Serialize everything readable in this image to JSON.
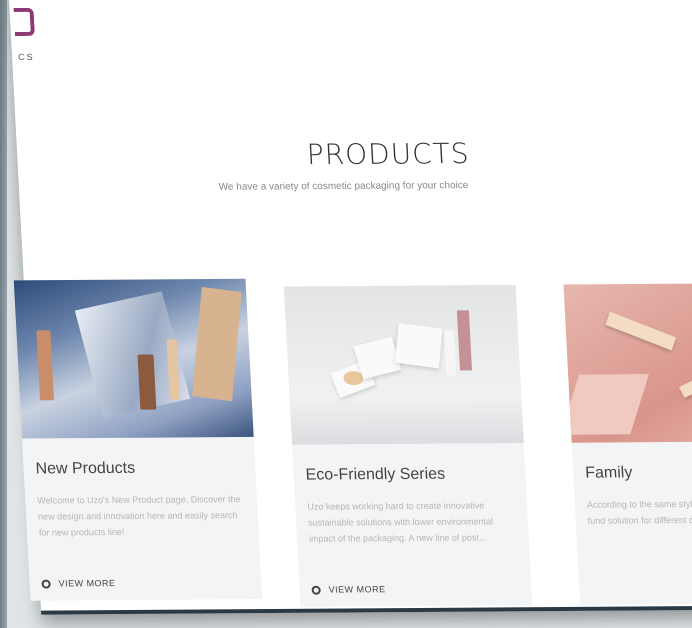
{
  "brand": {
    "logo_text": "CS"
  },
  "section": {
    "title": "PRODUCTS",
    "subtitle": "We have a variety of cosmetic packaging for your choice"
  },
  "cards": [
    {
      "title": "New Products",
      "description": "Welcome to Uzo's New Product page. Discover the new design and innovation here and easily search for new products line!",
      "link": "VIEW MORE"
    },
    {
      "title": "Eco-Friendly Series",
      "description": "Uzo keeps working hard to create innovative sustainable solutions with lower environmental impact of the packaging. A new line of post...",
      "link": "VIEW MORE"
    },
    {
      "title": "Family",
      "description": "According to the same style, family products is a fund solution for different categories of products",
      "link": ""
    }
  ],
  "colors": {
    "brand_accent": "#8c3a76",
    "card_background": "#f3f4f5"
  }
}
